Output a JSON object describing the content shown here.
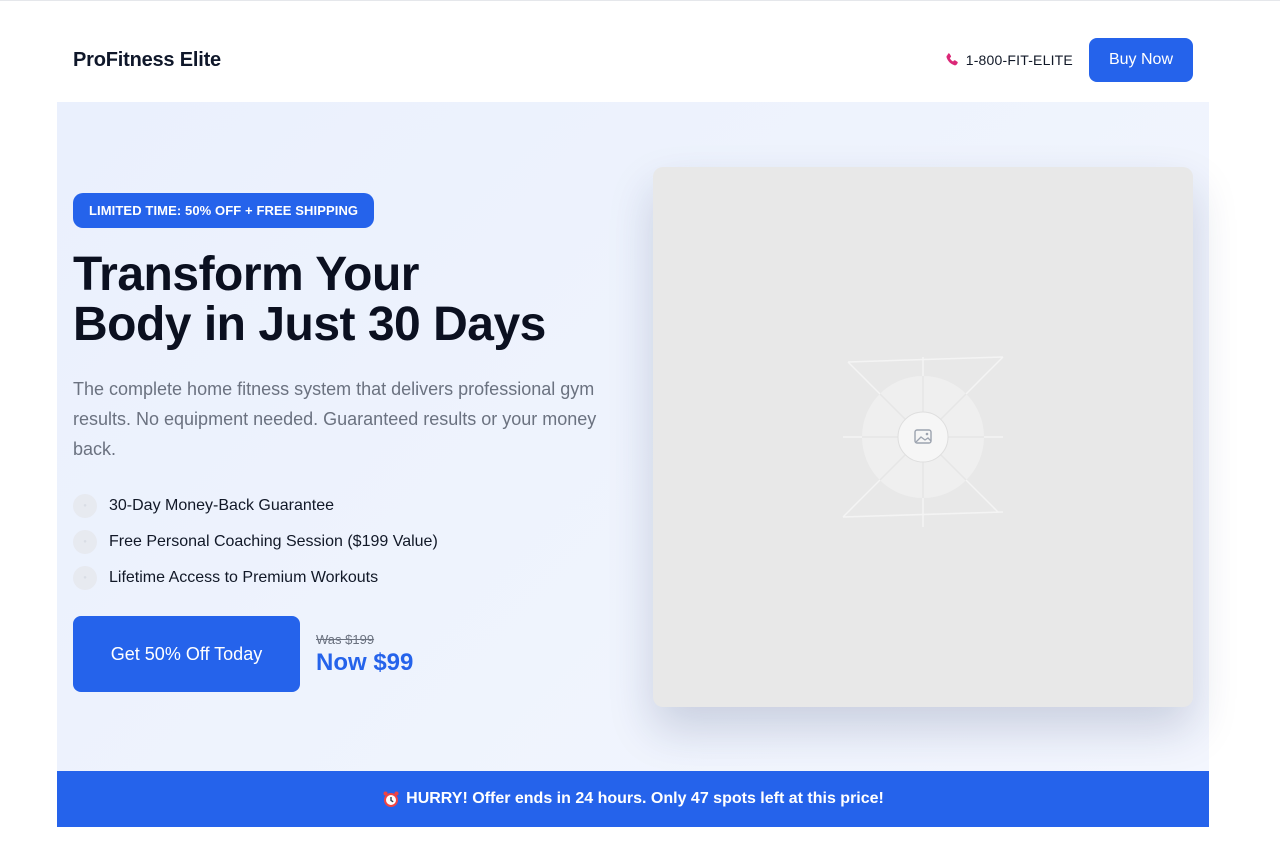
{
  "header": {
    "brand": "ProFitness Elite",
    "phone": "1-800-FIT-ELITE",
    "phone_icon": "phone-icon",
    "buy_label": "Buy Now"
  },
  "hero": {
    "badge": "LIMITED TIME: 50% OFF + FREE SHIPPING",
    "headline_line1": "Transform Your",
    "headline_line2": "Body in Just 30 Days",
    "subheadline": "The complete home fitness system that delivers professional gym results. No equipment needed. Guaranteed results or your money back.",
    "features": [
      {
        "label": "30-Day Money-Back Guarantee",
        "icon": "check-icon"
      },
      {
        "label": "Free Personal Coaching Session ($199 Value)",
        "icon": "check-icon"
      },
      {
        "label": "Lifetime Access to Premium Workouts",
        "icon": "check-icon"
      }
    ],
    "cta_label": "Get 50% Off Today",
    "price_was": "Was $199",
    "price_now": "Now $99",
    "image_placeholder_icon": "image-icon"
  },
  "urgency": {
    "icon": "alarm-clock-icon",
    "text": "HURRY! Offer ends in 24 hours. Only 47 spots left at this price!"
  },
  "colors": {
    "accent": "#2563eb",
    "hero_bg": "#eef3fd",
    "phone_icon": "#db2777",
    "image_placeholder": "#e8e8e8"
  }
}
